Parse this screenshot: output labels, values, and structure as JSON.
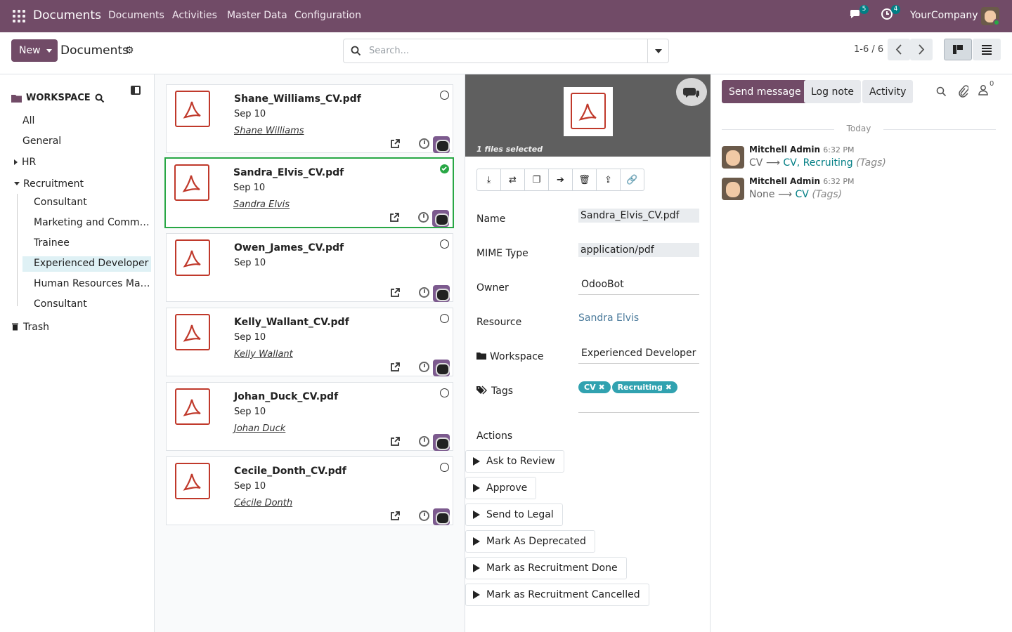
{
  "topbar": {
    "app_name": "Documents",
    "menu": [
      "Documents",
      "Activities",
      "Master Data",
      "Configuration"
    ],
    "messages_count": "5",
    "activities_count": "4",
    "company": "YourCompany"
  },
  "control": {
    "new_label": "New",
    "breadcrumb": "Documents",
    "search_placeholder": "Search...",
    "pager": "1-6 / 6"
  },
  "sidebar": {
    "workspace_title": "WORKSPACE",
    "items": {
      "all": "All",
      "general": "General",
      "hr": "HR",
      "recruitment": "Recruitment",
      "consultant": "Consultant",
      "marketing": "Marketing and Communication",
      "trainee": "Trainee",
      "experienced": "Experienced Developer",
      "human_resources": "Human Resources Management",
      "consultant2": "Consultant",
      "trash": "Trash"
    }
  },
  "cards": [
    {
      "name": "Shane_Williams_CV.pdf",
      "date": "Sep 10",
      "owner": "Shane Williams"
    },
    {
      "name": "Sandra_Elvis_CV.pdf",
      "date": "Sep 10",
      "owner": "Sandra Elvis"
    },
    {
      "name": "Owen_James_CV.pdf",
      "date": "Sep 10",
      "owner": ""
    },
    {
      "name": "Kelly_Wallant_CV.pdf",
      "date": "Sep 10",
      "owner": "Kelly Wallant"
    },
    {
      "name": "Johan_Duck_CV.pdf",
      "date": "Sep 10",
      "owner": "Johan Duck"
    },
    {
      "name": "Cecile_Donth_CV.pdf",
      "date": "Sep 10",
      "owner": "Cécile Donth"
    }
  ],
  "inspector": {
    "files_selected": "1 files selected",
    "labels": {
      "name": "Name",
      "mime": "MIME Type",
      "owner": "Owner",
      "resource": "Resource",
      "workspace": "Workspace",
      "tags": "Tags",
      "actions": "Actions"
    },
    "values": {
      "name": "Sandra_Elvis_CV.pdf",
      "mime": "application/pdf",
      "owner": "OdooBot",
      "resource": "Sandra Elvis",
      "workspace": "Experienced Developer"
    },
    "tags": [
      "CV",
      "Recruiting"
    ],
    "actions": [
      "Ask to Review",
      "Approve",
      "Send to Legal",
      "Mark As Deprecated",
      "Mark as Recruitment Done",
      "Mark as Recruitment Cancelled"
    ]
  },
  "chatter": {
    "send_message": "Send message",
    "log_note": "Log note",
    "activity": "Activity",
    "followers_count": "0",
    "date_separator": "Today",
    "messages": [
      {
        "author": "Mitchell Admin",
        "time": "6:32 PM",
        "old": "CV",
        "new": "CV, Recruiting",
        "field": "(Tags)"
      },
      {
        "author": "Mitchell Admin",
        "time": "6:32 PM",
        "old": "None",
        "new": "CV",
        "field": "(Tags)"
      }
    ]
  },
  "colors": {
    "brand": "#714B67",
    "accent": "#017e84",
    "pdf": "#c0392b",
    "selected": "#28a745"
  }
}
